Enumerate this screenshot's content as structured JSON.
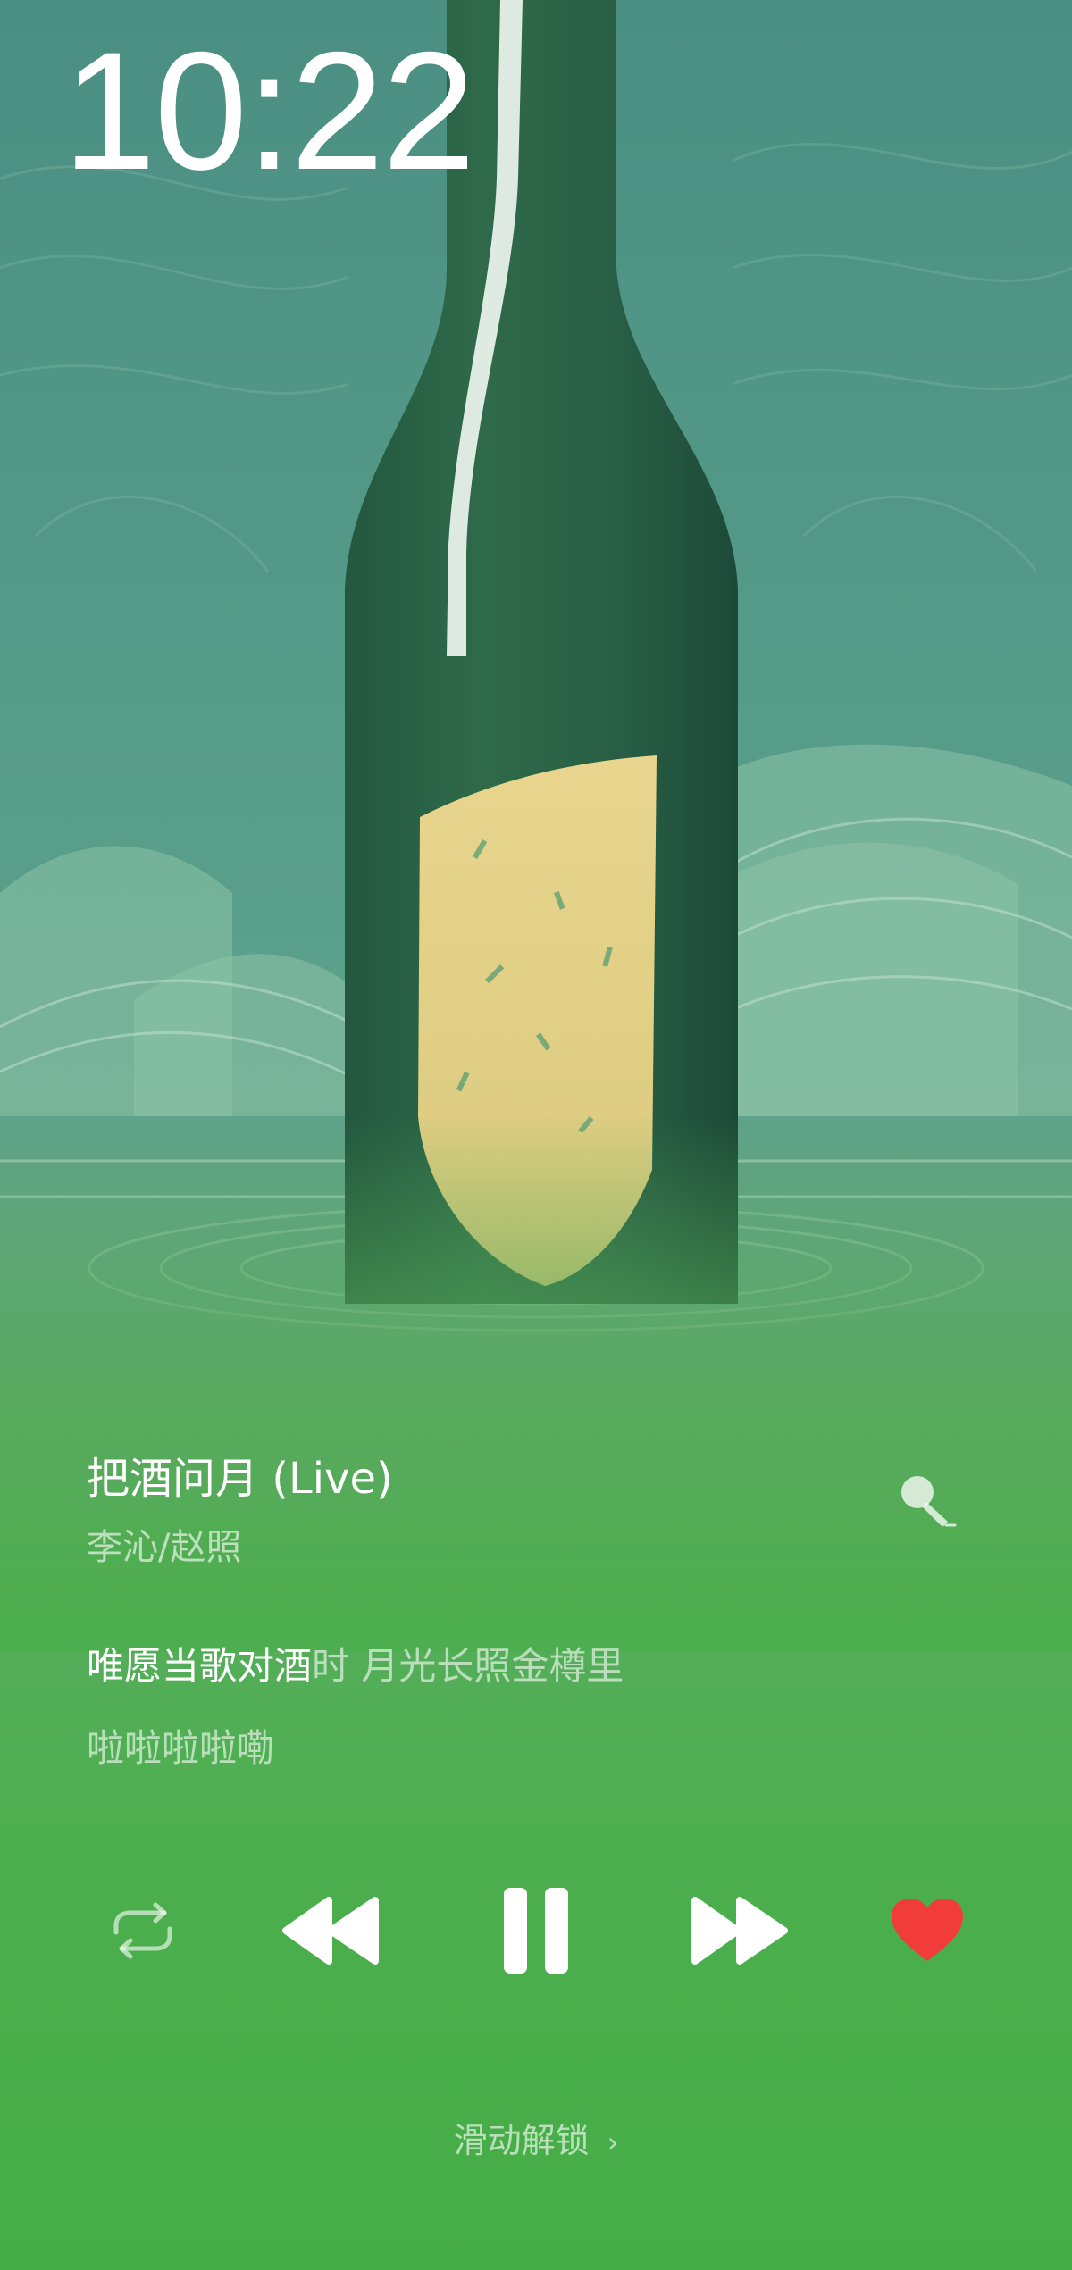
{
  "lockscreen": {
    "time": "10:22",
    "unlock_label": "滑动解锁",
    "unlock_chevron": "›"
  },
  "now_playing": {
    "title": "把酒问月 (Live)",
    "artist": "李沁/赵照",
    "lyrics": {
      "current_sung": "唯愿当歌对酒",
      "current_unsung": "时 月光长照金樽里",
      "next_line": "啦啦啦啦嘞"
    },
    "liked": true,
    "state": "playing"
  },
  "icons": {
    "mic": "microphone-icon",
    "repeat": "repeat-icon",
    "previous": "previous-track-icon",
    "pause": "pause-icon",
    "next": "next-track-icon",
    "like": "heart-icon"
  },
  "colors": {
    "accent_like": "#f23b3b",
    "background_bottom": "#45ad46",
    "artwork_teal": "#4f9a84"
  }
}
